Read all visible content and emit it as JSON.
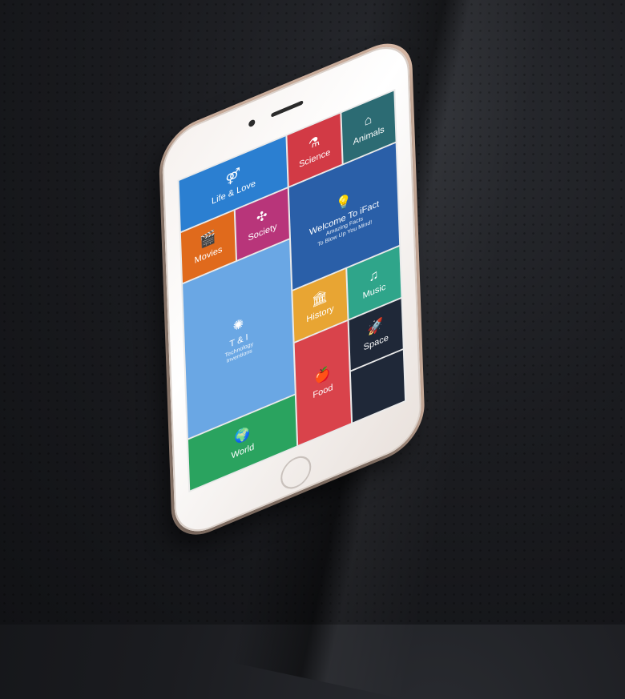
{
  "tiles": [
    {
      "id": "life-love",
      "label": "Life & Love",
      "icon": "gender-icon",
      "glyph": "⚤",
      "color": "#2b7fd1"
    },
    {
      "id": "science",
      "label": "Science",
      "icon": "flask-icon",
      "glyph": "⚗",
      "color": "#d23a45"
    },
    {
      "id": "animals",
      "label": "Animals",
      "icon": "paw-icon",
      "glyph": "⌂",
      "color": "#2c6b73"
    },
    {
      "id": "movies",
      "label": "Movies",
      "icon": "clapper-icon",
      "glyph": "🎬",
      "color": "#e06a1c"
    },
    {
      "id": "society",
      "label": "Society",
      "icon": "network-icon",
      "glyph": "✣",
      "color": "#b8357a"
    },
    {
      "id": "welcome",
      "label": "Welcome To iFact",
      "sub1": "Amazing Facts",
      "sub2": "To Blow Up You Mind!",
      "icon": "bulb-icon",
      "glyph": "💡",
      "color": "#2a5fa8"
    },
    {
      "id": "ti",
      "label": "T & I",
      "sub1": "Technology",
      "sub2": "Inventions",
      "icon": "brain-icon",
      "glyph": "✺",
      "color": "#6aa7e4"
    },
    {
      "id": "history",
      "label": "History",
      "icon": "museum-icon",
      "glyph": "🏛",
      "color": "#e8a533"
    },
    {
      "id": "music",
      "label": "Music",
      "icon": "guitar-icon",
      "glyph": "♫",
      "color": "#2fa58a"
    },
    {
      "id": "space",
      "label": "Space",
      "icon": "rocket-icon",
      "glyph": "🚀",
      "color": "#1f2838"
    },
    {
      "id": "world",
      "label": "World",
      "icon": "globe-icon",
      "glyph": "🌍",
      "color": "#2aa35f"
    },
    {
      "id": "food",
      "label": "Food",
      "icon": "apple-icon",
      "glyph": "🍎",
      "color": "#d9434b"
    }
  ]
}
